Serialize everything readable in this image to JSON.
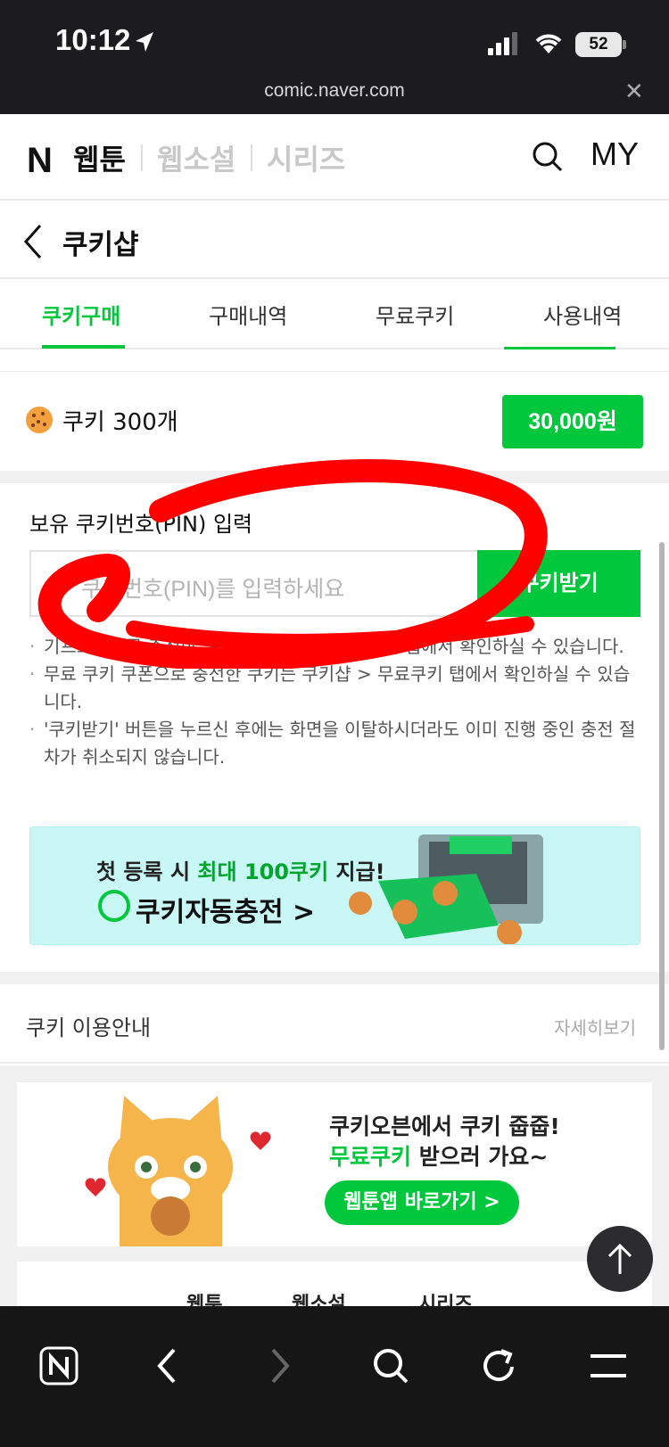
{
  "status": {
    "time": "10:12",
    "battery": "52",
    "url": "comic.naver.com"
  },
  "header": {
    "logo": "N",
    "tabs": [
      "웹툰",
      "웹소설",
      "시리즈"
    ],
    "my": "MY"
  },
  "subheader": {
    "title": "쿠키샵"
  },
  "tabs": [
    "쿠키구매",
    "구매내역",
    "무료쿠키",
    "사용내역"
  ],
  "product": {
    "label": "쿠키 300개",
    "price": "30,000원"
  },
  "pin": {
    "title": "보유 쿠키번호(PIN) 입력",
    "placeholder": "쿠키번호(PIN)를 입력하세요",
    "button": "쿠키받기"
  },
  "notes": [
    "기프트카드로 충전한 쿠키는 쿠키샵 > 구매내역 탭에서 확인하실 수 있습니다.",
    "무료 쿠키 쿠폰으로 충전한 쿠키는 쿠키샵 > 무료쿠키 탭에서 확인하실 수 있습니다.",
    "'쿠키받기' 버튼을 누르신 후에는 화면을 이탈하시더라도 이미 진행 중인 충전 절차가 취소되지 않습니다."
  ],
  "banner": {
    "line1_prefix": "첫 등록 시 ",
    "line1_highlight": "최대 100쿠키",
    "line1_suffix": " 지급!",
    "line2": "쿠키자동충전 >"
  },
  "guide": {
    "title": "쿠키 이용안내",
    "more": "자세히보기"
  },
  "promo": {
    "line1": "쿠키오븐에서 쿠키 줍줍!",
    "line2_highlight": "무료쿠키",
    "line2_suffix": " 받으러 가요~",
    "button": "웹툰앱 바로가기 >"
  },
  "footer_tabs": [
    "웹툰",
    "웹소설",
    "시리즈"
  ],
  "colors": {
    "accent": "#00c73c",
    "annotation": "#ff0000"
  }
}
